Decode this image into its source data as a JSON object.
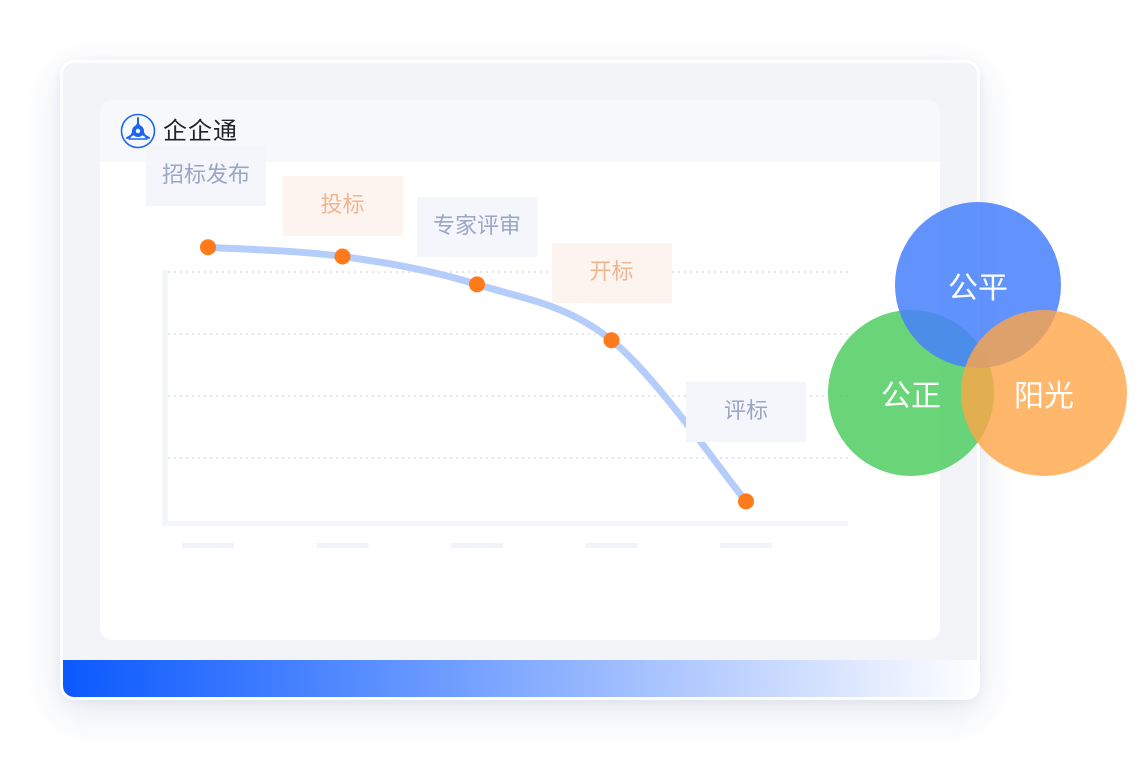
{
  "app": {
    "name": "企企通",
    "logo_icon": "qiqitong-logo-icon"
  },
  "colors": {
    "brand_blue": "#0a58ff",
    "curve": "#b5cdfb",
    "point": "#ff7a1a",
    "fair_circle": "#4780fb",
    "just_circle": "#50cd62",
    "sunshine_circle": "#ffa546"
  },
  "process": {
    "steps": [
      {
        "label": "招标发布",
        "style": "blue"
      },
      {
        "label": "投标",
        "style": "orange"
      },
      {
        "label": "专家评审",
        "style": "blue"
      },
      {
        "label": "开标",
        "style": "orange"
      },
      {
        "label": "评标",
        "style": "blue"
      }
    ]
  },
  "chart_data": {
    "type": "line",
    "title": "",
    "xlabel": "",
    "ylabel": "",
    "categories": [
      "招标发布",
      "投标",
      "专家评审",
      "开标",
      "评标"
    ],
    "values": [
      4.4,
      4.25,
      3.8,
      2.9,
      0.3
    ],
    "ylim": [
      0,
      5
    ],
    "grid": true,
    "smooth": true,
    "tick_labels_visible": false
  },
  "venn": {
    "circles": [
      {
        "label": "公平",
        "color": "#4780fb"
      },
      {
        "label": "公正",
        "color": "#50cd62"
      },
      {
        "label": "阳光",
        "color": "#ffa546"
      }
    ]
  }
}
